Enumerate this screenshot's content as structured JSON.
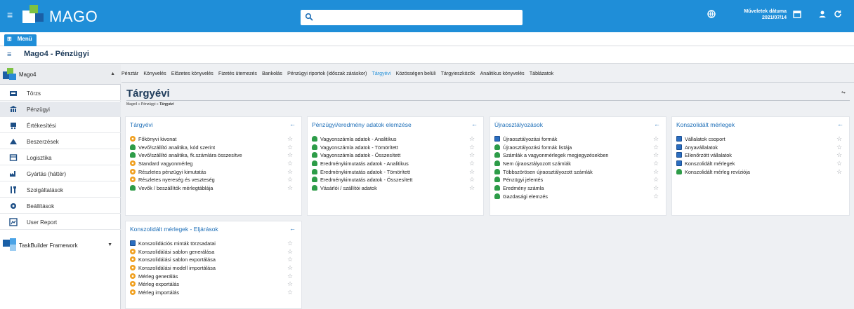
{
  "topbar": {
    "logo_text": "MAGO",
    "search_placeholder": "",
    "operation_date_label": "Műveletek dátuma",
    "operation_date_value": "2021/07/14"
  },
  "menu": {
    "tab_label": "Menü"
  },
  "titlebar": {
    "title": "Mago4 - Pénzügyi"
  },
  "sidebar": {
    "header": "Mago4",
    "items": [
      {
        "label": "Törzs",
        "icon": "folder-icon"
      },
      {
        "label": "Pénzügyi",
        "icon": "bank-icon"
      },
      {
        "label": "Értékesítési",
        "icon": "cart-icon"
      },
      {
        "label": "Beszerzések",
        "icon": "truck-icon"
      },
      {
        "label": "Logisztika",
        "icon": "box-icon"
      },
      {
        "label": "Gyártás (háttér)",
        "icon": "factory-icon"
      },
      {
        "label": "Szolgáltatások",
        "icon": "tools-icon"
      },
      {
        "label": "Beállítások",
        "icon": "settings-icon"
      },
      {
        "label": "User Report",
        "icon": "report-icon"
      }
    ],
    "footer": "TaskBuilder Framework"
  },
  "tabs": [
    "Pénztár",
    "Könyvelés",
    "Előzetes könyvelés",
    "Fizetés ütemezés",
    "Bankolás",
    "Pénzügyi riportok (időszak záráskor)",
    "Tárgyévi",
    "Közösségen belüli",
    "Tárgyieszközök",
    "Analitikus könyvelés",
    "Táblázatok"
  ],
  "page": {
    "title": "Tárgyévi",
    "breadcrumb": [
      "Mago4",
      "»",
      "Pénzügyi",
      "»",
      "Tárgyévi"
    ]
  },
  "cards": [
    {
      "title": "Tárgyévi",
      "collapse": "←",
      "items": [
        {
          "label": "Főkönyvi kivonat",
          "icon": "gear"
        },
        {
          "label": "Vevő/szállító analitika, kód szerint",
          "icon": "report"
        },
        {
          "label": "Vevő/szállító analitika, fk.számlára összesítve",
          "icon": "report"
        },
        {
          "label": "Standard vagyonmérleg",
          "icon": "gear"
        },
        {
          "label": "Részletes pénzügyi kimutatás",
          "icon": "gear"
        },
        {
          "label": "Részletes nyereség és veszteség",
          "icon": "gear"
        },
        {
          "label": "Vevők / beszállítók mérlegtáblája",
          "icon": "report"
        }
      ]
    },
    {
      "title": "Pénzügyi/eredmény adatok elemzése",
      "collapse": "←",
      "items": [
        {
          "label": "Vagyonszámla adatok - Analitikus",
          "icon": "report"
        },
        {
          "label": "Vagyonszámla adatok - Tömörített",
          "icon": "report"
        },
        {
          "label": "Vagyonszámla adatok - Összesített",
          "icon": "report"
        },
        {
          "label": "Eredménykimutatás adatok - Analitikus",
          "icon": "report"
        },
        {
          "label": "Eredménykimutatás adatok - Tömörített",
          "icon": "report"
        },
        {
          "label": "Eredménykimutatás adatok - Összesített",
          "icon": "report"
        },
        {
          "label": "Vásárlói / szállítói adatok",
          "icon": "report"
        }
      ]
    },
    {
      "title": "Újraosztályozások",
      "collapse": "←",
      "items": [
        {
          "label": "Újraosztályozási formák",
          "icon": "table"
        },
        {
          "label": "Újraosztályozási formák listája",
          "icon": "report"
        },
        {
          "label": "Számlák a vagyonmérlegek megjegyzésekben",
          "icon": "report"
        },
        {
          "label": "Nem újraosztályozott számlák",
          "icon": "report"
        },
        {
          "label": "Többszörösen újraosztályozott számlák",
          "icon": "report"
        },
        {
          "label": "Pénzügyi jelentés",
          "icon": "report"
        },
        {
          "label": "Eredmény számla",
          "icon": "report"
        },
        {
          "label": "Gazdasági elemzés",
          "icon": "report"
        }
      ]
    },
    {
      "title": "Konszolidált mérlegek",
      "collapse": "←",
      "items": [
        {
          "label": "Vállalatok csoport",
          "icon": "table"
        },
        {
          "label": "Anyavállalatok",
          "icon": "table"
        },
        {
          "label": "Ellenőrzött vállalatok",
          "icon": "table"
        },
        {
          "label": "Konszolidált mérlegek",
          "icon": "table"
        },
        {
          "label": "Konszolidált mérleg revíziója",
          "icon": "report"
        }
      ]
    },
    {
      "title": "Konszolidált mérlegek - Eljárások",
      "collapse": "←",
      "items": [
        {
          "label": "Konszolidációs minták törzsadatai",
          "icon": "table"
        },
        {
          "label": "Konszolidálási sablon generálása",
          "icon": "gear"
        },
        {
          "label": "Konszolidálási sablon exportálása",
          "icon": "gear"
        },
        {
          "label": "Konszolidálási modell importálása",
          "icon": "gear"
        },
        {
          "label": "Mérleg generálás",
          "icon": "gear"
        },
        {
          "label": "Mérleg exportálás",
          "icon": "gear"
        },
        {
          "label": "Mérleg importálás",
          "icon": "gear"
        }
      ]
    }
  ],
  "colors": {
    "accent": "#1f8ed8",
    "title": "#1e3b5a",
    "card_title": "#1e6fb8"
  }
}
